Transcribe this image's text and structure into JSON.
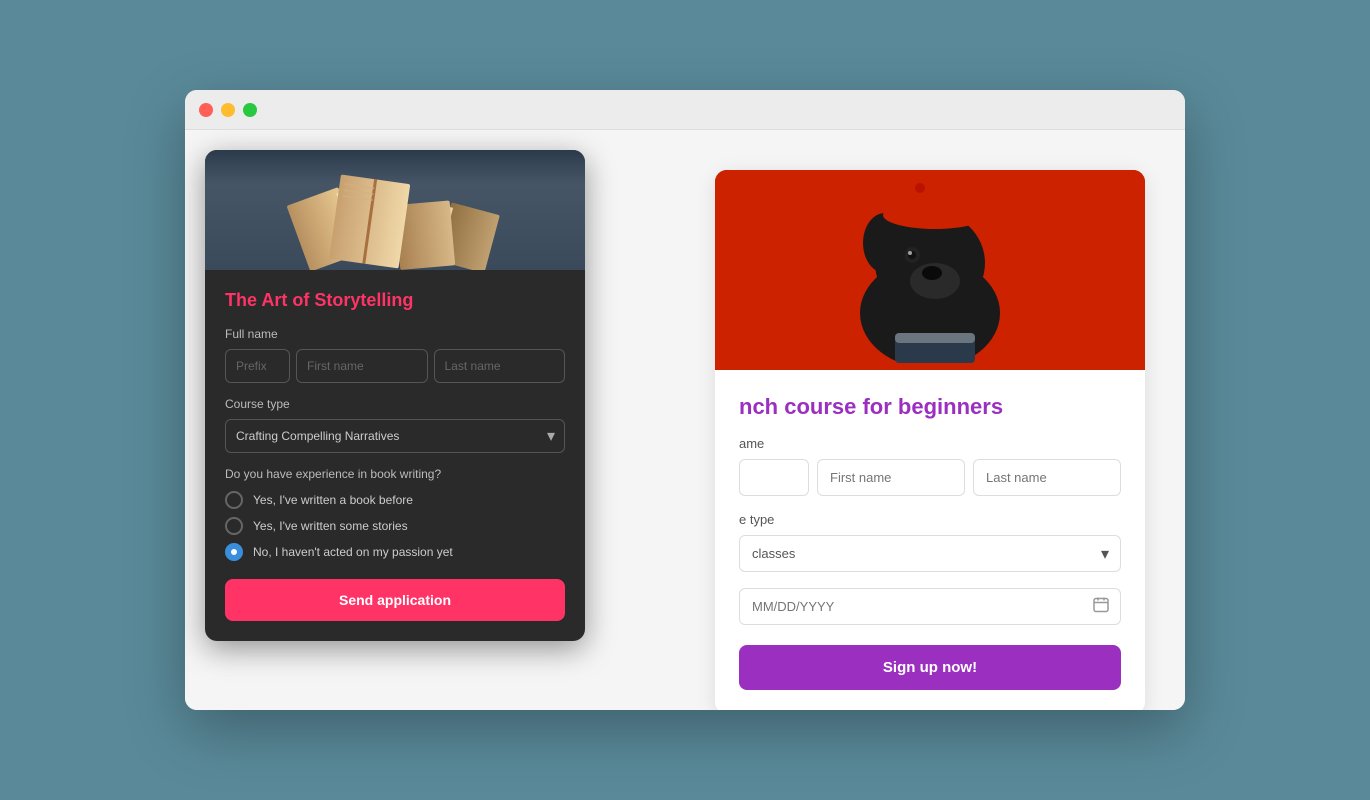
{
  "browser": {
    "traffic_lights": [
      "red",
      "yellow",
      "green"
    ]
  },
  "bg_card": {
    "title": "nch course for beginners",
    "form": {
      "name_label": "ame",
      "prefix_placeholder": "",
      "first_name_placeholder": "First name",
      "last_name_placeholder": "Last name",
      "course_type_label": "e type",
      "course_type_selected": "classes",
      "date_placeholder": "MM/DD/YYYY",
      "signup_button": "Sign up now!"
    }
  },
  "fg_modal": {
    "title": "The Art of Storytelling",
    "form": {
      "name_label": "Full name",
      "prefix_placeholder": "Prefix",
      "first_name_placeholder": "First name",
      "last_name_placeholder": "Last name",
      "course_type_label": "Course type",
      "course_type_selected": "Crafting Compelling Narratives",
      "experience_label": "Do you have experience in book writing?",
      "radio_options": [
        {
          "id": "opt1",
          "label": "Yes, I've written a book before",
          "selected": false
        },
        {
          "id": "opt2",
          "label": "Yes, I've written some stories",
          "selected": false
        },
        {
          "id": "opt3",
          "label": "No, I haven't acted on my passion yet",
          "selected": true
        }
      ],
      "send_button": "Send application"
    }
  }
}
